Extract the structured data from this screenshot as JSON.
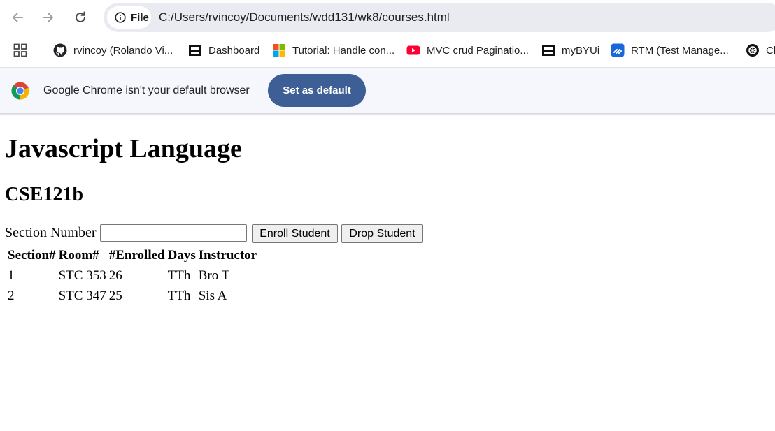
{
  "browser": {
    "site_chip": "File",
    "url": "C:/Users/rvincoy/Documents/wdd131/wk8/courses.html",
    "bookmarks": [
      {
        "label": "rvincoy (Rolando Vi...",
        "icon": "github-icon"
      },
      {
        "label": "Dashboard",
        "icon": "byu-idaho-icon"
      },
      {
        "label": "Tutorial: Handle con...",
        "icon": "microsoft-icon"
      },
      {
        "label": "MVC crud Paginatio...",
        "icon": "youtube-icon"
      },
      {
        "label": "myBYUi",
        "icon": "byu-idaho-icon"
      },
      {
        "label": "RTM (Test Manage...",
        "icon": "jira-icon"
      },
      {
        "label": "Ch",
        "icon": "openai-icon"
      }
    ],
    "infobar": {
      "message": "Google Chrome isn't your default browser",
      "button": "Set as default"
    },
    "colors": {
      "infobar_button": "#3d5f95",
      "omnibox": "#e9ebf1"
    }
  },
  "page": {
    "title": "Javascript Language",
    "course_code": "CSE121b",
    "form": {
      "label": "Section Number",
      "value": "",
      "enroll_button": "Enroll Student",
      "drop_button": "Drop Student"
    },
    "table": {
      "headers": [
        "Section#",
        "Room#",
        "#Enrolled",
        "Days",
        "Instructor"
      ],
      "rows": [
        [
          "1",
          "STC 353",
          "26",
          "TTh",
          "Bro T"
        ],
        [
          "2",
          "STC 347",
          "25",
          "TTh",
          "Sis A"
        ]
      ]
    }
  }
}
